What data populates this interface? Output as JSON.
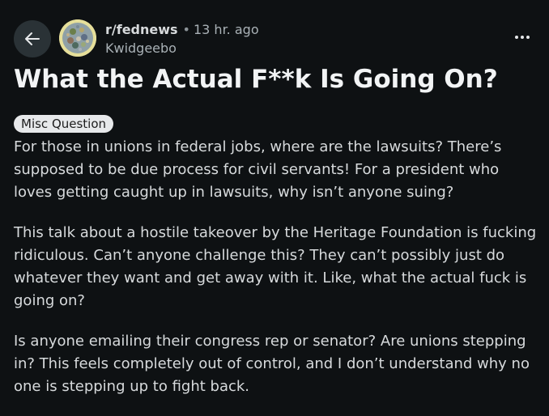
{
  "post": {
    "subreddit": "r/fednews",
    "separator": "•",
    "time_ago": "13 hr. ago",
    "author": "Kwidgeebo",
    "title": "What the Actual F**k Is Going On?",
    "flair": "Misc Question",
    "paragraphs": [
      "For those in unions in federal jobs, where are the lawsuits? There’s supposed to be due process for civil servants! For a president who loves getting caught up in lawsuits, why isn’t anyone suing?",
      "This talk about a hostile takeover by the Heritage Foundation is fucking ridiculous. Can’t anyone challenge this? They can’t possibly just do whatever they want and get away with it. Like, what the actual fuck is going on?",
      "Is anyone emailing their congress rep or senator? Are unions stepping in? This feels completely out of control, and I don’t understand why no one is stepping up to fight back."
    ]
  },
  "icons": {
    "back": "back-arrow-icon",
    "more": "more-options-icon",
    "avatar": "subreddit-avatar"
  },
  "colors": {
    "background": "#0e1113",
    "text": "#d7dadc",
    "title": "#f2f4f5",
    "muted": "#a9b1b6",
    "flair_bg": "#e7e9eb",
    "button_bg": "#2a3236"
  }
}
